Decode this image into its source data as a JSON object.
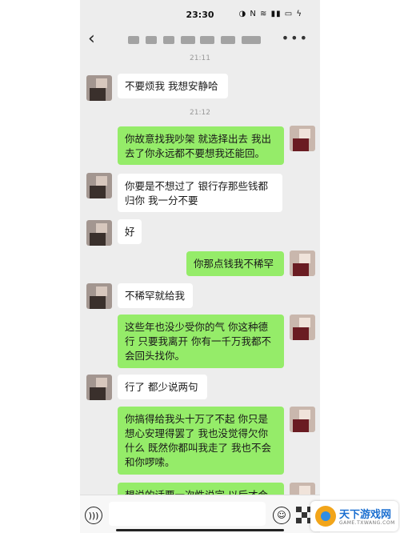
{
  "status": {
    "time": "23:30",
    "icons_text": "◑ N ≋ ▮▮ ▭ ϟ"
  },
  "header": {
    "back_icon": "chevron-left-icon",
    "more_label": "•••"
  },
  "messages": [
    {
      "side": "in",
      "text": "不要烦我 我想安静哈"
    },
    {
      "side": "out",
      "text": "你故意找我吵架 就选择出去 我出去了你永远都不要想我还能回。"
    },
    {
      "side": "in",
      "text": "你要是不想过了 银行存那些钱都归你 我一分不要"
    },
    {
      "side": "in",
      "text": "好"
    },
    {
      "side": "out",
      "text": "你那点钱我不稀罕"
    },
    {
      "side": "in",
      "text": "不稀罕就给我"
    },
    {
      "side": "out",
      "text": "这些年也没少受你的气 你这种德行 只要我离开 你有一千万我都不会回头找你。"
    },
    {
      "side": "in",
      "text": "行了 都少说两句"
    },
    {
      "side": "out",
      "text": "你搞得给我头十万了不起 你只是想心安理得罢了 我也没觉得欠你什么 既然你都叫我走了 我也不会和你啰嗦。"
    },
    {
      "side": "out",
      "text": "想说的话要一次性说完 以后才会"
    }
  ],
  "timestamps": [
    "21:11",
    "21:12"
  ],
  "input": {
    "placeholder": ""
  },
  "watermark": {
    "title": "天下游戏网",
    "subtitle": "GAME.TXWANG.COM"
  },
  "colors": {
    "bubble_out": "#95ec69",
    "bubble_in": "#ffffff",
    "chat_bg": "#ededed"
  }
}
